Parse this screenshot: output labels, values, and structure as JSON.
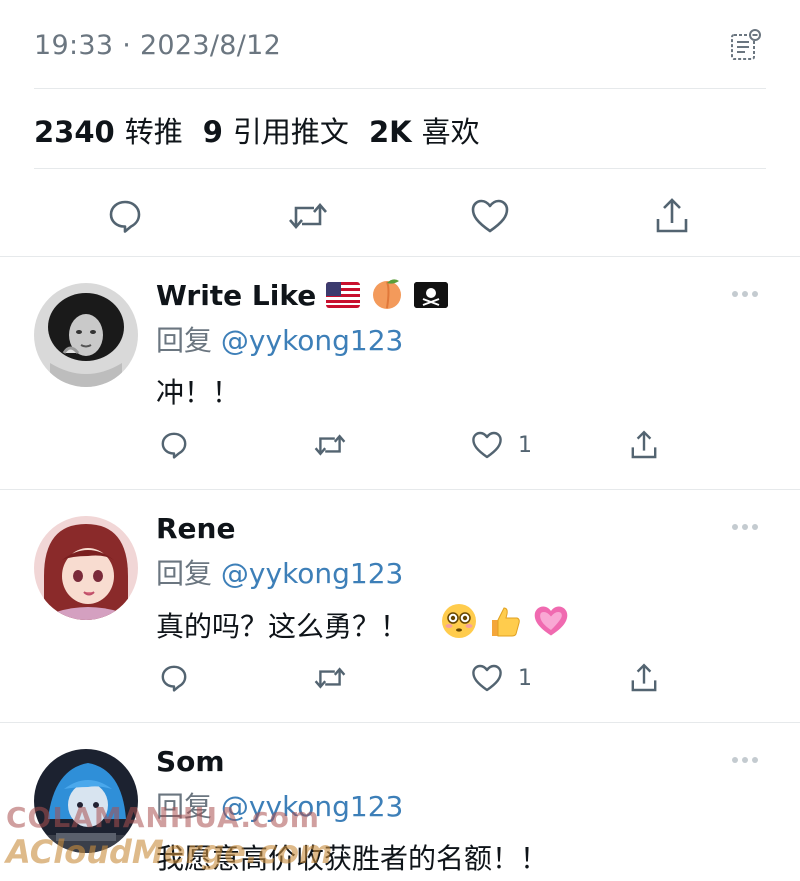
{
  "tweet": {
    "timestamp": "19:33 · 2023/8/12",
    "stats": [
      {
        "num": "2340",
        "label": "转推"
      },
      {
        "num": "9",
        "label": "引用推文"
      },
      {
        "num": "2K",
        "label": "喜欢"
      }
    ],
    "actions": [
      "reply-icon",
      "retweet-icon",
      "like-icon",
      "share-icon"
    ]
  },
  "replies": [
    {
      "name": "Write Like",
      "badges": [
        "us-flag-emoji",
        "peach-emoji",
        "pirate-flag-emoji"
      ],
      "reply_prefix": "回复",
      "reply_handle": "@yykong123",
      "text": "冲！！",
      "like_count": "1"
    },
    {
      "name": "Rene",
      "badges": [],
      "reply_prefix": "回复",
      "reply_handle": "@yykong123",
      "text": "真的吗？这么勇？！",
      "emojis": [
        "flushed-emoji",
        "thumbs-up-emoji",
        "heart-emoji"
      ],
      "like_count": "1"
    },
    {
      "name": "Som",
      "badges": [],
      "reply_prefix": "回复",
      "reply_handle": "@yykong123",
      "text": "我愿意高价收获胜者的名额！！"
    }
  ],
  "watermark": {
    "line1": "COLAMANHUA.com",
    "line2": "ACloudMerge.com"
  },
  "colors": {
    "text": "#0f1419",
    "secondary": "#6b7680",
    "link": "#3d7fb8",
    "divider": "#e6e9eb"
  }
}
